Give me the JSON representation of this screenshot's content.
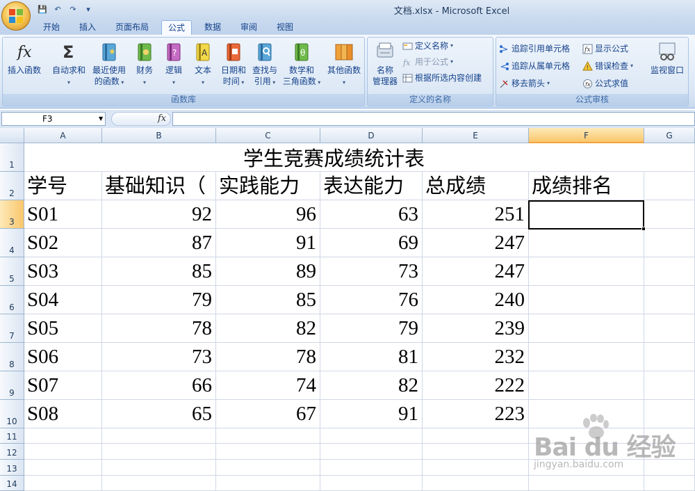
{
  "window": {
    "title": "文档.xlsx - Microsoft Excel"
  },
  "qat": {
    "save": "💾",
    "undo": "↶",
    "redo": "↷",
    "more": "▾"
  },
  "tabs": [
    "开始",
    "插入",
    "页面布局",
    "公式",
    "数据",
    "审阅",
    "视图"
  ],
  "active_tab": "公式",
  "ribbon": {
    "function_library": {
      "label": "函数库",
      "insert_function": "插入函数",
      "autosum": "自动求和",
      "recent_line1": "最近使用",
      "recent_line2": "的函数",
      "financial": "财务",
      "logical": "逻辑",
      "text": "文本",
      "datetime_line1": "日期和",
      "datetime_line2": "时间",
      "lookup_line1": "查找与",
      "lookup_line2": "引用",
      "math_line1": "数学和",
      "math_line2": "三角函数",
      "more": "其他函数"
    },
    "defined_names": {
      "label": "定义的名称",
      "name_manager_line1": "名称",
      "name_manager_line2": "管理器",
      "define_name": "定义名称",
      "use_in_formula": "用于公式",
      "create_from_selection": "根据所选内容创建"
    },
    "formula_auditing": {
      "label": "公式审核",
      "trace_precedents": "追踪引用单元格",
      "trace_dependents": "追踪从属单元格",
      "remove_arrows": "移去箭头",
      "show_formulas": "显示公式",
      "error_checking": "错误检查",
      "evaluate_formula": "公式求值",
      "watch_window": "监视窗口"
    }
  },
  "formula_bar": {
    "name_box": "F3",
    "fx": "fx",
    "content": ""
  },
  "sheet": {
    "columns": [
      "A",
      "B",
      "C",
      "D",
      "E",
      "F",
      "G"
    ],
    "rows": [
      "1",
      "2",
      "3",
      "4",
      "5",
      "6",
      "7",
      "8",
      "9",
      "10",
      "11",
      "12",
      "13",
      "14"
    ],
    "title": "学生竞赛成绩统计表",
    "headers": [
      "学号",
      "基础知识（",
      "实践能力",
      "表达能力",
      "总成绩",
      "成绩排名"
    ],
    "data": [
      [
        "S01",
        "92",
        "96",
        "63",
        "251"
      ],
      [
        "S02",
        "87",
        "91",
        "69",
        "247"
      ],
      [
        "S03",
        "85",
        "89",
        "73",
        "247"
      ],
      [
        "S04",
        "79",
        "85",
        "76",
        "240"
      ],
      [
        "S05",
        "78",
        "82",
        "79",
        "239"
      ],
      [
        "S06",
        "73",
        "78",
        "81",
        "232"
      ],
      [
        "S07",
        "66",
        "74",
        "82",
        "222"
      ],
      [
        "S08",
        "65",
        "67",
        "91",
        "223"
      ]
    ],
    "selected_cell": "F3"
  },
  "watermark": {
    "main": "Bai du 经验",
    "sub": "jingyan.baidu.com"
  }
}
